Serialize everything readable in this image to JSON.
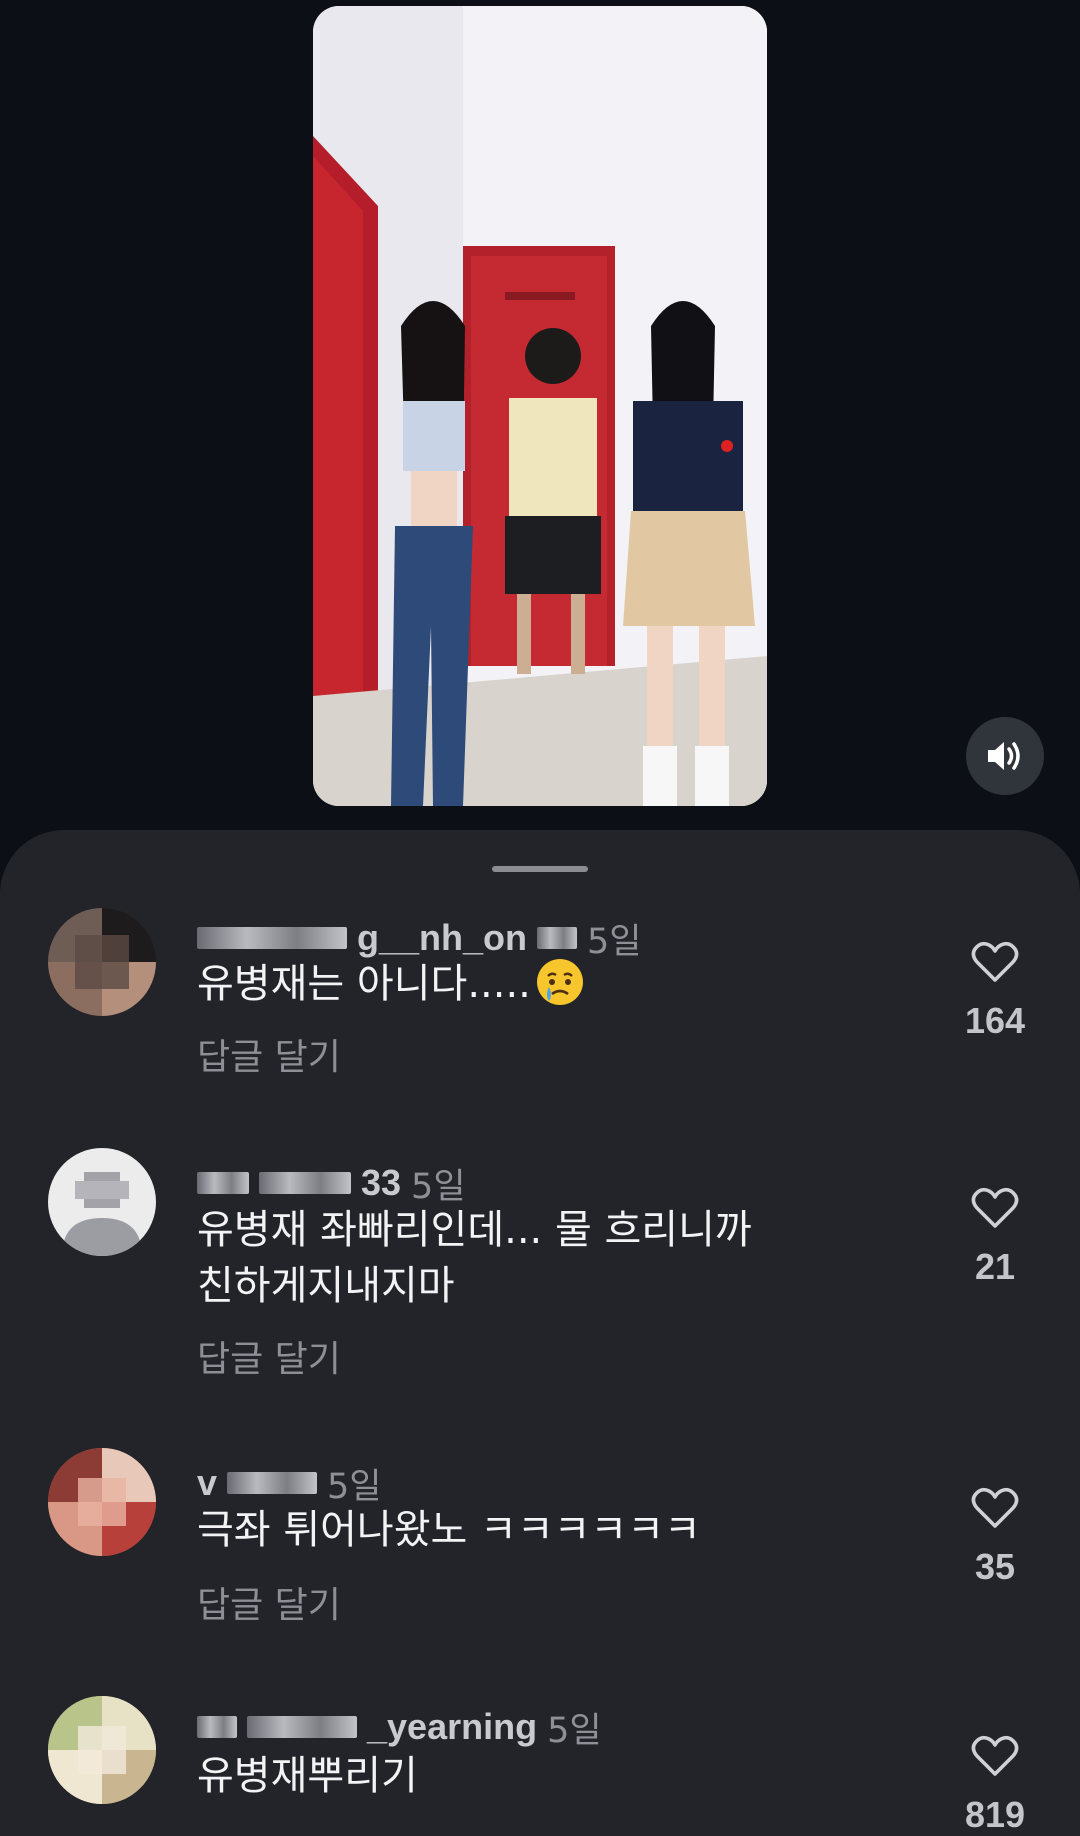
{
  "comments": [
    {
      "username_visible": "g__nh_on",
      "time": "5일",
      "text": "유병재는 아니다.....",
      "emoji": "crying-face",
      "reply": "답글 달기",
      "likes": "164"
    },
    {
      "username_visible": "33",
      "time": "5일",
      "text": "유병재 좌빠리인데... 물 흐리니까\n친하게지내지마",
      "reply": "답글 달기",
      "likes": "21"
    },
    {
      "username_visible": "v",
      "time": "5일",
      "text": "극좌 튀어나왔노 ㅋㅋㅋㅋㅋㅋ",
      "reply": "답글 달기",
      "likes": "35"
    },
    {
      "username_visible": "_yearning",
      "time": "5일",
      "text": "유병재뿌리기",
      "likes": "819"
    }
  ],
  "colors": {
    "background": "#0c1016",
    "sheet": "#232429",
    "muted_text": "#8e8f96"
  }
}
